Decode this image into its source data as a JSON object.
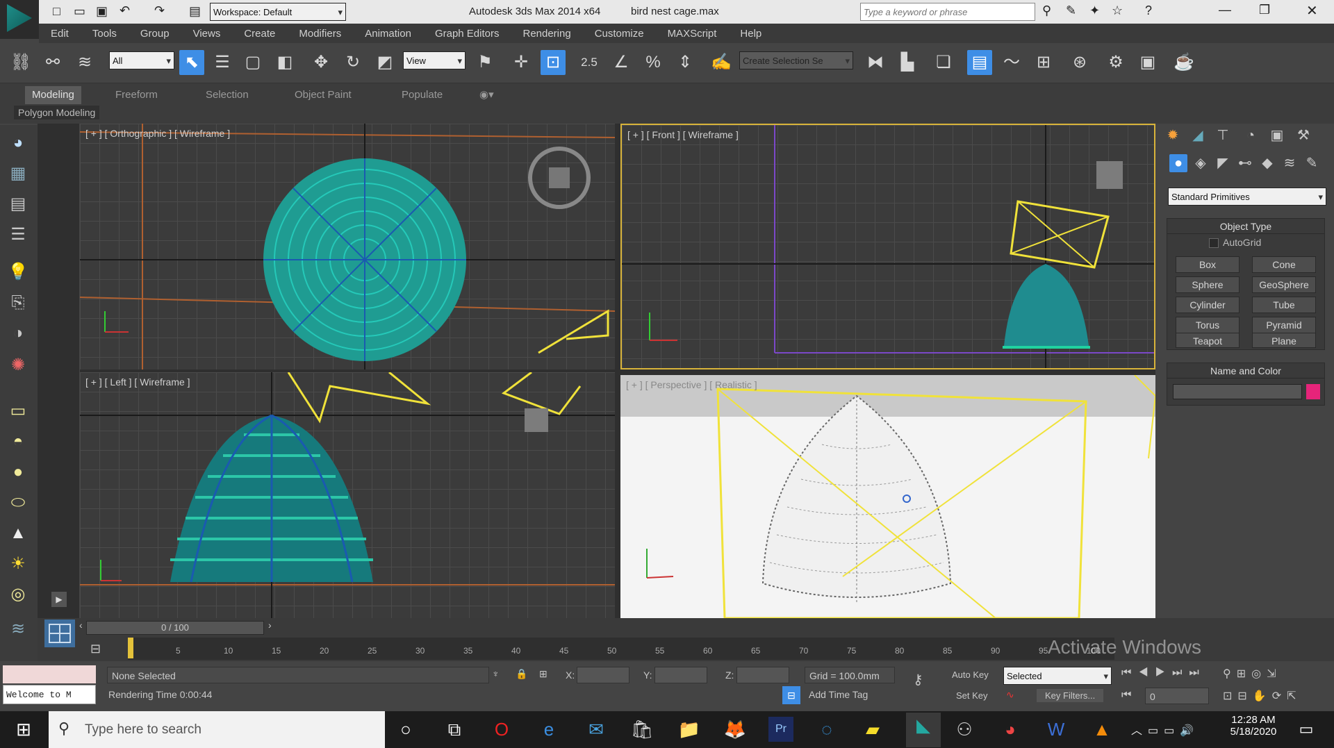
{
  "titlebar": {
    "app_title": "Autodesk 3ds Max  2014 x64",
    "file_name": "bird nest cage.max",
    "workspace": "Workspace: Default",
    "search_placeholder": "Type a keyword or phrase"
  },
  "menu": [
    "Edit",
    "Tools",
    "Group",
    "Views",
    "Create",
    "Modifiers",
    "Animation",
    "Graph Editors",
    "Rendering",
    "Customize",
    "MAXScript",
    "Help"
  ],
  "toolbar": {
    "selection_filter": "All",
    "ref_coord": "View",
    "named_selection": "Create Selection Se",
    "snap_label": "2.5"
  },
  "ribbon": {
    "tabs": [
      "Modeling",
      "Freeform",
      "Selection",
      "Object Paint",
      "Populate"
    ],
    "subtitle": "Polygon Modeling"
  },
  "viewports": {
    "top_left": "[ + ] [ Orthographic ] [ Wireframe ]",
    "top_right": "[ + ] [ Front ] [ Wireframe ]",
    "bottom_left": "[ + ] [ Left ] [ Wireframe ]",
    "bottom_right": "[ + ] [ Perspective ] [ Realistic ]"
  },
  "command_panel": {
    "category": "Standard Primitives",
    "object_type_title": "Object Type",
    "autogrid": "AutoGrid",
    "primitives": [
      "Box",
      "Cone",
      "Sphere",
      "GeoSphere",
      "Cylinder",
      "Tube",
      "Torus",
      "Pyramid",
      "Teapot",
      "Plane"
    ],
    "name_color_title": "Name and Color",
    "object_color": "#e6247a"
  },
  "timeline": {
    "frame": "0 / 100",
    "ticks": [
      "5",
      "10",
      "15",
      "20",
      "25",
      "30",
      "35",
      "40",
      "45",
      "50",
      "55",
      "60",
      "65",
      "70",
      "75",
      "80",
      "85",
      "90",
      "95",
      "100"
    ]
  },
  "status": {
    "maxscript": "Welcome to M",
    "selection": "None Selected",
    "render_time": "Rendering Time  0:00:44",
    "x": "X:",
    "y": "Y:",
    "z": "Z:",
    "grid": "Grid = 100.0mm",
    "add_time_tag": "Add Time Tag",
    "auto_key": "Auto Key",
    "selected": "Selected",
    "set_key": "Set Key",
    "key_filters": "Key Filters...",
    "frame_value": "0"
  },
  "watermark": "Activate Windows",
  "taskbar": {
    "search_placeholder": "Type here to search",
    "time": "12:28 AM",
    "date": "5/18/2020"
  },
  "colors": {
    "accent": "#3e8ee6",
    "wire_teal": "#1fbfb0",
    "gizmo_yellow": "#f0e23a",
    "frame_gold": "#d9b43a"
  }
}
